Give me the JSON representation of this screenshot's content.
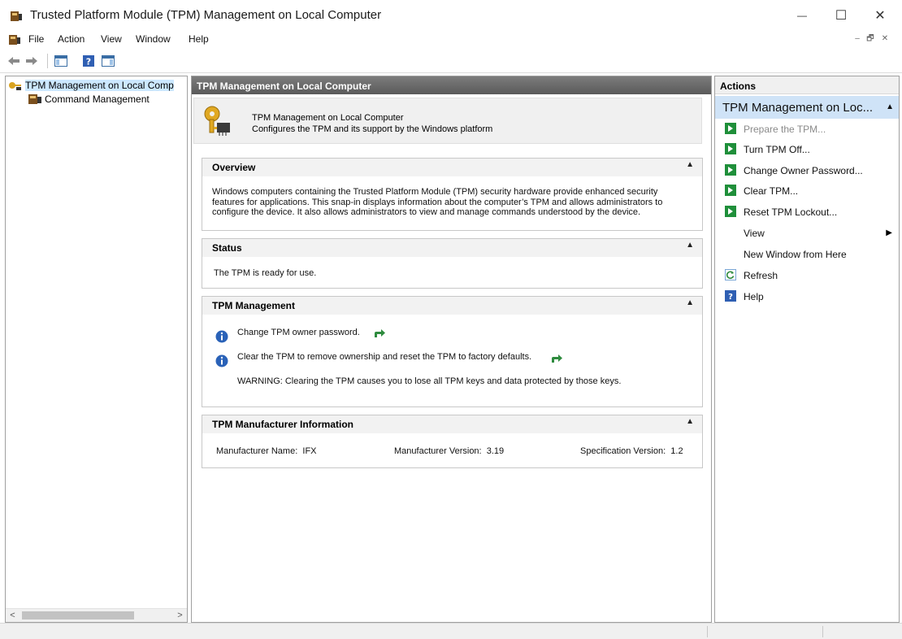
{
  "window": {
    "title": "Trusted Platform Module (TPM) Management on Local Computer",
    "minimize_glyph": "—",
    "maximize_glyph": "☐",
    "close_glyph": "✕"
  },
  "menu": {
    "items": [
      "File",
      "Action",
      "View",
      "Window",
      "Help"
    ],
    "mdi_minimize": "–",
    "mdi_restore": "🗗",
    "mdi_close": "✕"
  },
  "toolbar": {
    "buttons": [
      "back-arrow-icon",
      "forward-arrow-icon",
      "show-hide-console-tree-icon",
      "help-icon",
      "show-hide-action-pane-icon"
    ]
  },
  "tree": {
    "root_label": "TPM Management on Local Comp",
    "child_label": "Command Management",
    "scroll_left": "<",
    "scroll_right": ">"
  },
  "center": {
    "header": "TPM Management on Local Computer",
    "banner": {
      "line1": "TPM Management on Local Computer",
      "line2": "Configures the TPM and its support by the Windows platform"
    },
    "overview": {
      "title": "Overview",
      "lines": [
        "Windows computers containing the Trusted Platform Module (TPM) security hardware provide enhanced security",
        "features for applications. This snap-in displays information about the computer’s TPM and allows administrators to",
        "configure the device. It also allows administrators to view and manage commands understood by the device."
      ]
    },
    "status": {
      "title": "Status",
      "text": "The TPM is ready for use."
    },
    "management": {
      "title": "TPM Management",
      "item1": "Change TPM owner password.",
      "item2": "Clear the TPM to remove ownership and reset the TPM to factory defaults.",
      "warning": "WARNING: Clearing the TPM causes you to lose all TPM keys and data protected by those keys."
    },
    "manufacturer": {
      "title": "TPM Manufacturer Information",
      "name_label": "Manufacturer Name:",
      "name_value": "IFX",
      "version_label": "Manufacturer Version:",
      "version_value": "3.19",
      "spec_label": "Specification Version:",
      "spec_value": "1.2"
    },
    "collapse_glyph": "▲"
  },
  "actions": {
    "header": "Actions",
    "group": "TPM Management on Loc...",
    "items": [
      {
        "label": "Prepare the TPM...",
        "disabled": true,
        "icon": "green-action-icon"
      },
      {
        "label": "Turn TPM Off...",
        "disabled": false,
        "icon": "green-action-icon"
      },
      {
        "label": "Change Owner Password...",
        "disabled": false,
        "icon": "green-action-icon"
      },
      {
        "label": "Clear TPM...",
        "disabled": false,
        "icon": "green-action-icon"
      },
      {
        "label": "Reset TPM Lockout...",
        "disabled": false,
        "icon": "green-action-icon"
      },
      {
        "label": "View",
        "disabled": false,
        "icon": "",
        "submenu": true
      },
      {
        "label": "New Window from Here",
        "disabled": false,
        "icon": ""
      },
      {
        "label": "Refresh",
        "disabled": false,
        "icon": "refresh-icon"
      },
      {
        "label": "Help",
        "disabled": false,
        "icon": "help-icon"
      }
    ],
    "submenu_glyph": "▶",
    "colors": {
      "selected_bg": "#cfe3f7",
      "action_green": "#1f8f3a"
    }
  },
  "colors": {
    "center_header_bg": "#666666",
    "tree_selected_bg": "#cce8ff"
  }
}
